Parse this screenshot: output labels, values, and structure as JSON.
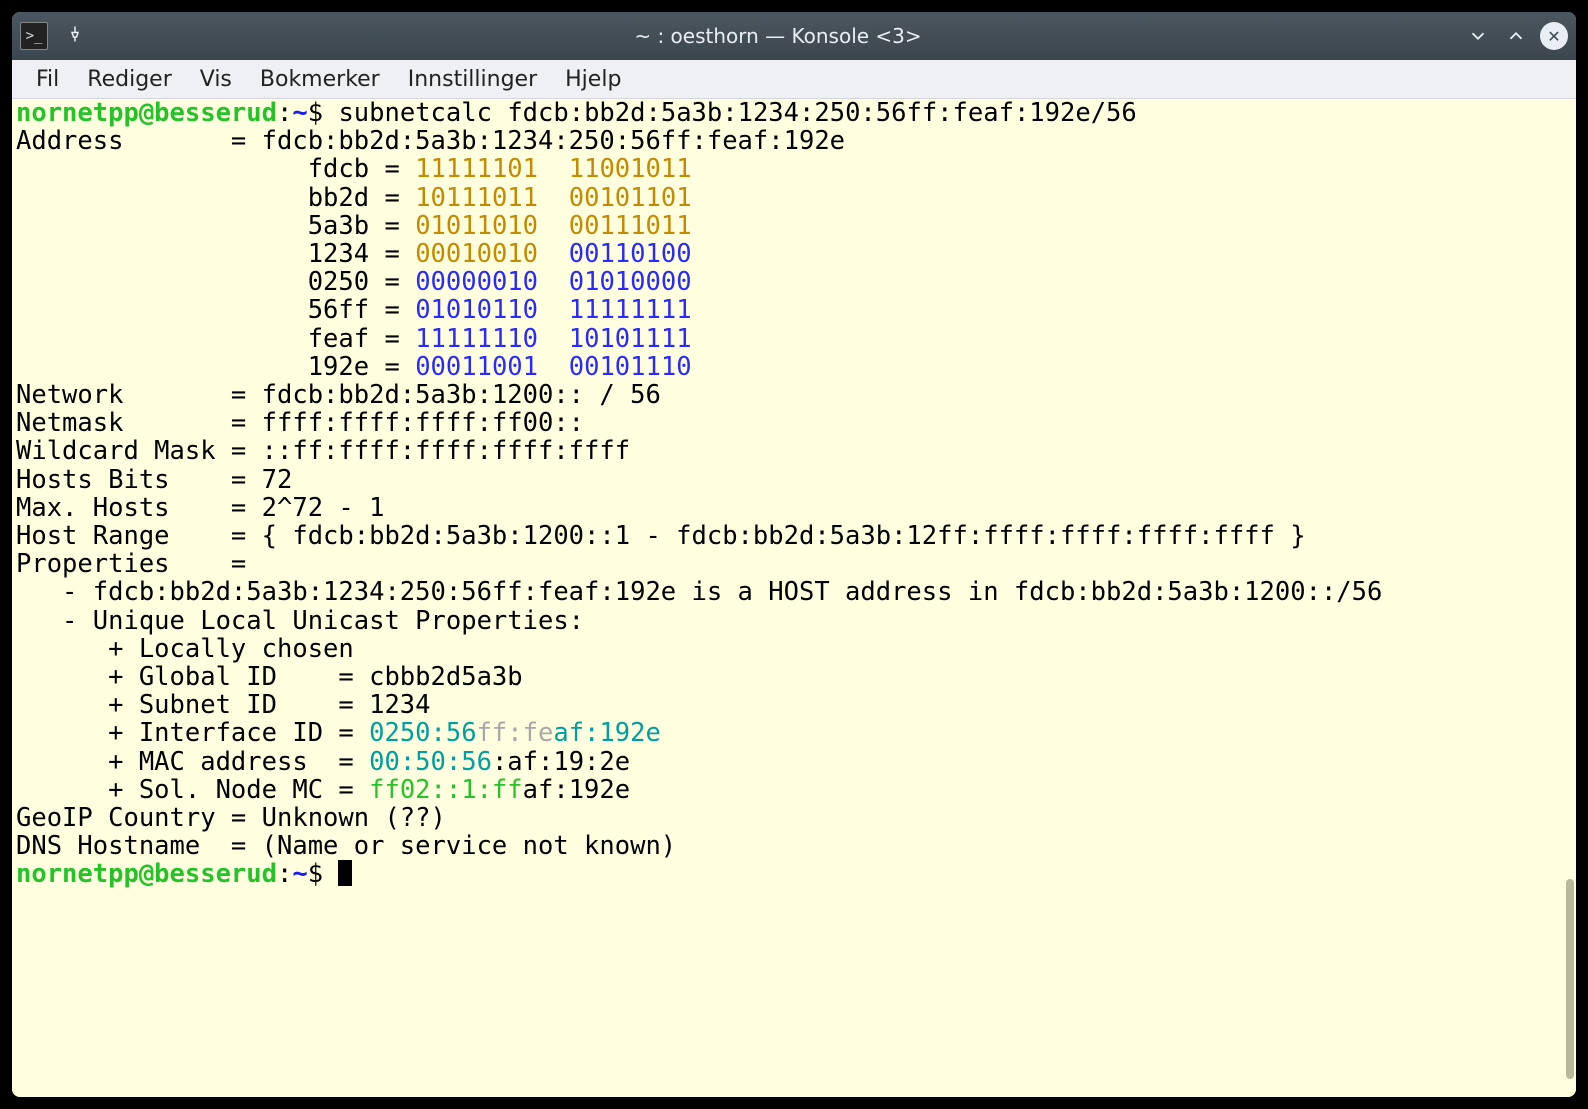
{
  "window": {
    "title": "~ : oesthorn — Konsole <3>"
  },
  "menubar": {
    "items": [
      "Fil",
      "Rediger",
      "Vis",
      "Bokmerker",
      "Innstillinger",
      "Hjelp"
    ]
  },
  "prompt": {
    "user_host": "nornetpp@besserud",
    "sep": ":",
    "path": "~",
    "symbol": "$"
  },
  "command": "subnetcalc fdcb:bb2d:5a3b:1234:250:56ff:feaf:192e/56",
  "address_line": {
    "label": "Address       = ",
    "value": "fdcb:bb2d:5a3b:1234:250:56ff:feaf:192e"
  },
  "hex_lines": [
    {
      "pad": "                   ",
      "hex": "fdcb",
      "eq": " = ",
      "b1": "11111101",
      "sp": "  ",
      "b2": "11001011",
      "color": "orange"
    },
    {
      "pad": "                   ",
      "hex": "bb2d",
      "eq": " = ",
      "b1": "10111011",
      "sp": "  ",
      "b2": "00101101",
      "color": "orange"
    },
    {
      "pad": "                   ",
      "hex": "5a3b",
      "eq": " = ",
      "b1": "01011010",
      "sp": "  ",
      "b2": "00111011",
      "color": "orange"
    },
    {
      "pad": "                   ",
      "hex": "1234",
      "eq": " = ",
      "b1": "00010010",
      "sp": "  ",
      "b2": "00110100",
      "color": "split"
    },
    {
      "pad": "                   ",
      "hex": "0250",
      "eq": " = ",
      "b1": "00000010",
      "sp": "  ",
      "b2": "01010000",
      "color": "dblue"
    },
    {
      "pad": "                   ",
      "hex": "56ff",
      "eq": " = ",
      "b1": "01010110",
      "sp": "  ",
      "b2": "11111111",
      "color": "dblue"
    },
    {
      "pad": "                   ",
      "hex": "feaf",
      "eq": " = ",
      "b1": "11111110",
      "sp": "  ",
      "b2": "10101111",
      "color": "dblue"
    },
    {
      "pad": "                   ",
      "hex": "192e",
      "eq": " = ",
      "b1": "00011001",
      "sp": "  ",
      "b2": "00101110",
      "color": "dblue"
    }
  ],
  "fields": {
    "network": "Network       = fdcb:bb2d:5a3b:1200:: / 56",
    "netmask": "Netmask       = ffff:ffff:ffff:ff00::",
    "wildcard": "Wildcard Mask = ::ff:ffff:ffff:ffff:ffff",
    "hostbits": "Hosts Bits    = 72",
    "maxhosts": "Max. Hosts    = 2^72 - 1",
    "hostrange": "Host Range    = { fdcb:bb2d:5a3b:1200::1 - fdcb:bb2d:5a3b:12ff:ffff:ffff:ffff:ffff }",
    "properties": "Properties    ="
  },
  "props": {
    "line1": "   - fdcb:bb2d:5a3b:1234:250:56ff:feaf:192e is a HOST address in fdcb:bb2d:5a3b:1200::/56",
    "line2": "   - Unique Local Unicast Properties:",
    "line3": "      + Locally chosen",
    "line4": "      + Global ID    = cbbb2d5a3b",
    "line5": "      + Subnet ID    = 1234",
    "iface": {
      "prefix": "      + Interface ID = ",
      "p1": "0250:56",
      "p2": "ff:fe",
      "p3": "af:192e"
    },
    "mac": {
      "prefix": "      + MAC address  = ",
      "p1": "00:50:56",
      "p2": ":af:19:2e"
    },
    "sol": {
      "prefix": "      + Sol. Node MC = ",
      "p1": "ff02::1:ff",
      "p2": "af:192e"
    }
  },
  "geoip": "GeoIP Country = Unknown (??)",
  "dns": "DNS Hostname  = (Name or service not known)"
}
